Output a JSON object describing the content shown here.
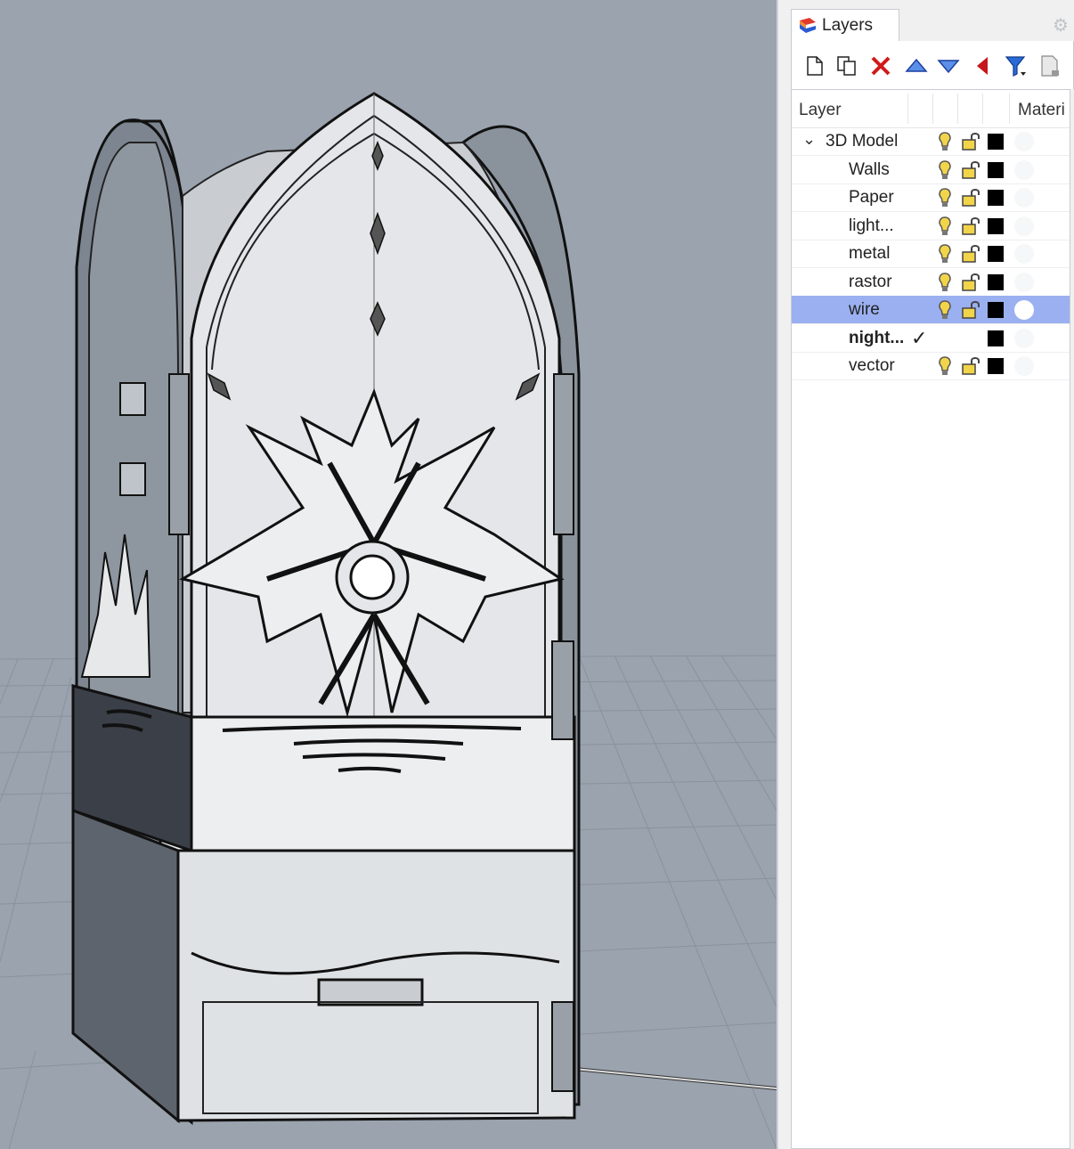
{
  "panel": {
    "tab_label": "Layers",
    "columns": {
      "layer": "Layer",
      "material": "Materi"
    }
  },
  "toolbar_icons": [
    "new-layer-icon",
    "copy-layer-icon",
    "delete-icon",
    "move-up-icon",
    "move-down-icon",
    "back-icon",
    "filter-icon",
    "properties-icon"
  ],
  "layers": [
    {
      "name": "3D Model",
      "level": 0,
      "expanded": true,
      "bold": false,
      "selected": false,
      "current": false,
      "visible": true,
      "locked": false,
      "color": "#000000"
    },
    {
      "name": "Walls",
      "level": 1,
      "bold": false,
      "selected": false,
      "current": false,
      "visible": true,
      "locked": false,
      "color": "#000000"
    },
    {
      "name": "Paper",
      "level": 1,
      "bold": false,
      "selected": false,
      "current": false,
      "visible": true,
      "locked": false,
      "color": "#000000"
    },
    {
      "name": "light...",
      "level": 1,
      "bold": false,
      "selected": false,
      "current": false,
      "visible": true,
      "locked": false,
      "color": "#000000"
    },
    {
      "name": "metal",
      "level": 1,
      "bold": false,
      "selected": false,
      "current": false,
      "visible": true,
      "locked": false,
      "color": "#000000"
    },
    {
      "name": "rastor",
      "level": 1,
      "bold": false,
      "selected": false,
      "current": false,
      "visible": true,
      "locked": false,
      "color": "#000000"
    },
    {
      "name": "wire",
      "level": 1,
      "bold": false,
      "selected": true,
      "current": false,
      "visible": true,
      "locked": false,
      "color": "#000000"
    },
    {
      "name": "night...",
      "level": 1,
      "bold": true,
      "selected": false,
      "current": true,
      "check_mark": "✓",
      "visible": true,
      "locked": false,
      "color": "#000000"
    },
    {
      "name": "vector",
      "level": 1,
      "bold": false,
      "selected": false,
      "current": false,
      "visible": true,
      "locked": false,
      "color": "#000000"
    }
  ],
  "colors": {
    "viewport_bg": "#9aa3ae",
    "selection": "#9bb0f0",
    "bulb": "#f2d44a",
    "lock": "#f2d44a"
  }
}
